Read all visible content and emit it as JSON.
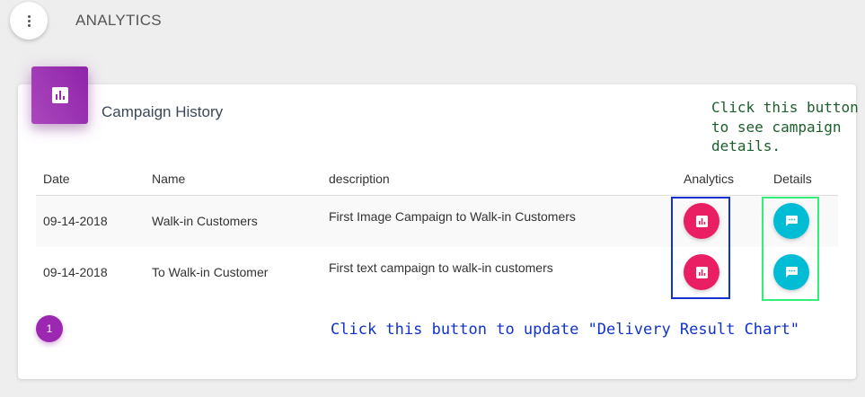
{
  "header": {
    "title": "ANALYTICS",
    "menu_icon": "vertical-dots-icon"
  },
  "card": {
    "title": "Campaign History",
    "icon": "bar-chart-icon",
    "accent_color": "#9c27b0"
  },
  "table": {
    "columns": [
      "Date",
      "Name",
      "description",
      "Analytics",
      "Details"
    ],
    "rows": [
      {
        "date": "09-14-2018",
        "name": "Walk-in Customers",
        "description": "First Image Campaign to Walk-in Customers"
      },
      {
        "date": "09-14-2018",
        "name": "To Walk-in Customer",
        "description": "First text campaign to walk-in customers"
      }
    ],
    "analytics_button_icon": "bar-chart-icon",
    "analytics_button_color": "#e91e63",
    "details_button_icon": "speech-bubble-icon",
    "details_button_color": "#00bcd4"
  },
  "pagination": {
    "current_page": "1"
  },
  "annotations": {
    "details_note": "Click this button to see campaign details.",
    "analytics_note": "Click this button to update \"Delivery Result Chart\"",
    "analytics_box_color": "#1133cc",
    "details_box_color": "#33ee77"
  }
}
